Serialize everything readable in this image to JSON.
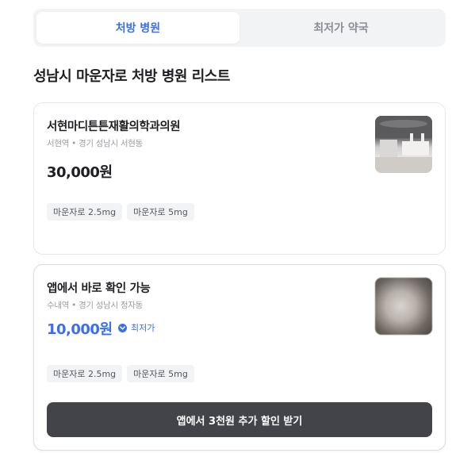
{
  "tabs": [
    {
      "label": "처방 병원",
      "active": true
    },
    {
      "label": "최저가 약국",
      "active": false
    }
  ],
  "page_title": "성남시 마운자로 처방 병원 리스트",
  "colors": {
    "accent": "#3a6ff0",
    "cta_bg": "#43444a",
    "chip_bg": "#f2f3f5"
  },
  "clinics": [
    {
      "name": "서현마디튼튼재활의학과의원",
      "address": "서현역 • 경기 성남시 서현동",
      "price": "30,000원",
      "chips": [
        "마운자로 2.5mg",
        "마운자로 5mg"
      ]
    },
    {
      "name": "앱에서 바로 확인 가능",
      "address": "수내역 • 경기 성남시 정자동",
      "price": "10,000원",
      "badge": "최저가",
      "chips": [
        "마운자로 2.5mg",
        "마운자로 5mg"
      ],
      "cta_label": "앱에서 3천원 추가 할인 받기"
    }
  ]
}
